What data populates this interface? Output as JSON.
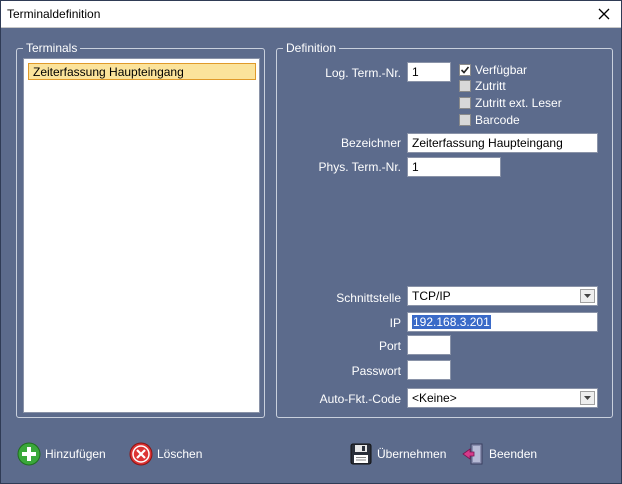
{
  "window": {
    "title": "Terminaldefinition"
  },
  "terminals": {
    "group_label": "Terminals",
    "items": [
      {
        "label": "Zeiterfassung Haupteingang"
      }
    ]
  },
  "definition": {
    "group_label": "Definition",
    "log_term_nr": {
      "label": "Log. Term.-Nr.",
      "value": "1"
    },
    "checkboxes": [
      {
        "label": "Verfügbar",
        "checked": true
      },
      {
        "label": "Zutritt",
        "checked": false
      },
      {
        "label": "Zutritt ext. Leser",
        "checked": false
      },
      {
        "label": "Barcode",
        "checked": false
      }
    ],
    "bezeichner": {
      "label": "Bezeichner",
      "value": "Zeiterfassung Haupteingang"
    },
    "phys_term_nr": {
      "label": "Phys. Term.-Nr.",
      "value": "1"
    },
    "schnittstelle": {
      "label": "Schnittstelle",
      "value": "TCP/IP"
    },
    "ip": {
      "label": "IP",
      "value": "192.168.3.201"
    },
    "port": {
      "label": "Port",
      "value": ""
    },
    "passwort": {
      "label": "Passwort",
      "value": ""
    },
    "auto_fkt_code": {
      "label": "Auto-Fkt.-Code",
      "value": "<Keine>"
    }
  },
  "buttons": {
    "add": "Hinzufügen",
    "delete": "Löschen",
    "apply": "Übernehmen",
    "exit": "Beenden"
  },
  "colors": {
    "background": "#5c6b8c",
    "selection": "#fbe39b",
    "selection_border": "#e09a2a",
    "ip_highlight": "#3a6ac8"
  }
}
